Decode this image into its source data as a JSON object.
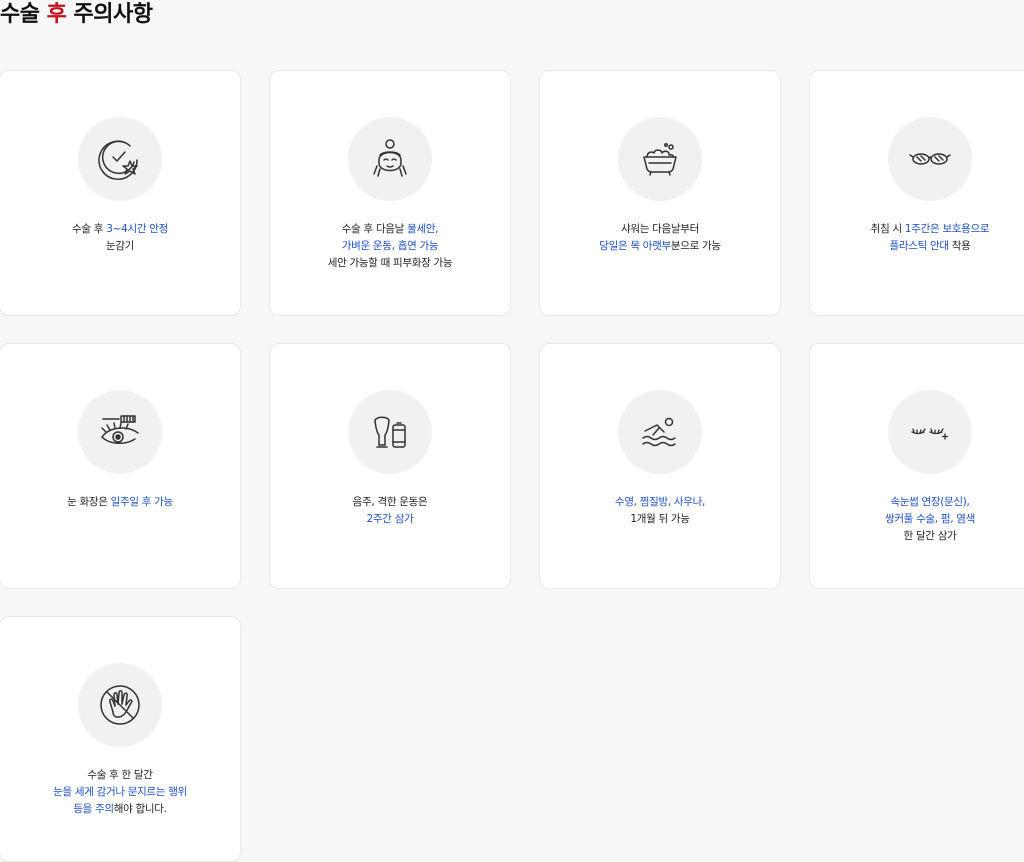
{
  "header": {
    "title_before": "수술 ",
    "title_accent": "후",
    "title_after": " 주의사항"
  },
  "colors": {
    "accent": "#c1121f",
    "highlight": "#1f4fc7",
    "text": "#222222",
    "card_bg": "#ffffff",
    "icon_bg": "#f1f1f1"
  },
  "cards": [
    {
      "icon": "clock-star-icon",
      "lines": [
        [
          {
            "t": "수술 후 ",
            "hl": false
          },
          {
            "t": "3~4시간 안정",
            "hl": true
          }
        ],
        [
          {
            "t": "눈감기",
            "hl": false
          }
        ]
      ]
    },
    {
      "icon": "face-wash-icon",
      "lines": [
        [
          {
            "t": "수술 후 다음날 ",
            "hl": false
          },
          {
            "t": "물세안,",
            "hl": true
          }
        ],
        [
          {
            "t": "가벼운 운동, 흡연 가능",
            "hl": true
          }
        ],
        [
          {
            "t": "세안 가능할 때 피부화장 가능",
            "hl": false
          }
        ]
      ]
    },
    {
      "icon": "bathtub-icon",
      "lines": [
        [
          {
            "t": "샤워는 다음날부터",
            "hl": false
          }
        ],
        [
          {
            "t": "당일은 목 아랫부",
            "hl": true
          },
          {
            "t": "분으로 가능",
            "hl": false
          }
        ]
      ]
    },
    {
      "icon": "glasses-icon",
      "lines": [
        [
          {
            "t": "취침 시 ",
            "hl": false
          },
          {
            "t": "1주간은 보호용으로",
            "hl": true
          }
        ],
        [
          {
            "t": "플라스틱 안대",
            "hl": true
          },
          {
            "t": " 착용",
            "hl": false
          }
        ]
      ]
    },
    {
      "icon": "eye-mascara-icon",
      "lines": [
        [
          {
            "t": "눈 화장은 ",
            "hl": false
          },
          {
            "t": "일주일 후 가능",
            "hl": true
          }
        ]
      ]
    },
    {
      "icon": "beer-can-icon",
      "lines": [
        [
          {
            "t": "음주, 격한 운동은",
            "hl": false
          }
        ],
        [
          {
            "t": "2주간 삼가",
            "hl": true
          }
        ]
      ]
    },
    {
      "icon": "swimming-icon",
      "lines": [
        [
          {
            "t": "수영, 찜질방, 사우나,",
            "hl": true
          }
        ],
        [
          {
            "t": "1개월 뒤 가능",
            "hl": false
          }
        ]
      ]
    },
    {
      "icon": "eyelash-sparkle-icon",
      "lines": [
        [
          {
            "t": "속눈썹 연장(문신),",
            "hl": true
          }
        ],
        [
          {
            "t": "쌍커풀 수술, 펌, 염색",
            "hl": true
          }
        ],
        [
          {
            "t": "한 달간 삼가",
            "hl": false
          }
        ]
      ]
    },
    {
      "icon": "no-touch-hand-icon",
      "lines": [
        [
          {
            "t": "수술 후 한 달간",
            "hl": false
          }
        ],
        [
          {
            "t": "눈을 세게 감거나 문지르는 행위",
            "hl": true
          }
        ],
        [
          {
            "t": "등을 주의",
            "hl": true
          },
          {
            "t": "해야 합니다.",
            "hl": false
          }
        ]
      ]
    }
  ]
}
